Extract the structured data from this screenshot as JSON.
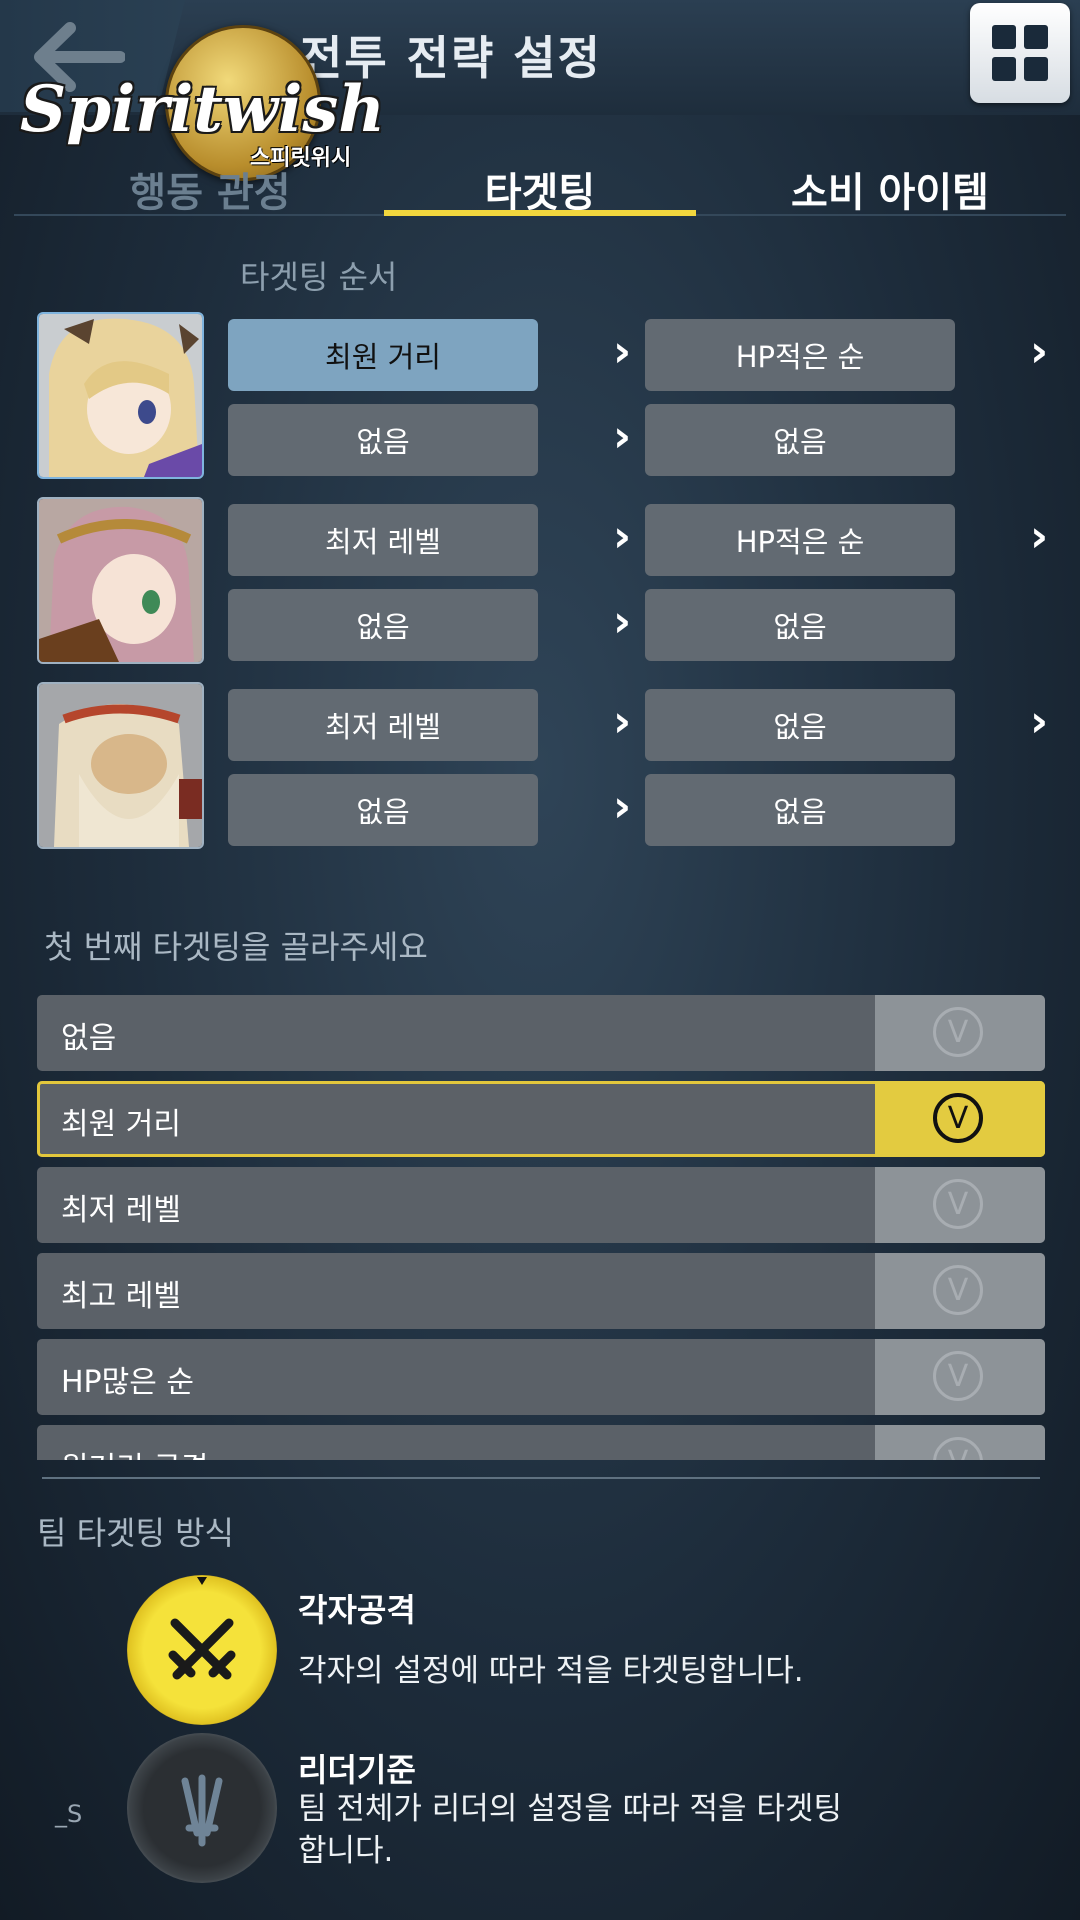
{
  "header": {
    "title": "전투 전략 설정"
  },
  "logo": {
    "name": "Spiritwish",
    "subtitle": "스피릿위시"
  },
  "tabs": [
    {
      "label": "행동 관정",
      "state": "partially-hidden"
    },
    {
      "label": "타겟팅",
      "state": "active"
    },
    {
      "label": "소비 아이템",
      "state": "inactive"
    }
  ],
  "targeting_order": {
    "label": "타겟팅 순서",
    "characters": [
      {
        "row1": [
          "최원 거리",
          "HP적은 순"
        ],
        "row2": [
          "없음",
          "없음"
        ],
        "selected_slot": "row1-0"
      },
      {
        "row1": [
          "최저 레벨",
          "HP적은 순"
        ],
        "row2": [
          "없음",
          "없음"
        ]
      },
      {
        "row1": [
          "최저 레벨",
          "없음"
        ],
        "row2": [
          "없음",
          "없음"
        ]
      }
    ]
  },
  "first_targeting": {
    "prompt": "첫 번째 타겟팅을 골라주세요",
    "options": [
      {
        "label": "없음",
        "selected": false
      },
      {
        "label": "최원 거리",
        "selected": true
      },
      {
        "label": "최저 레벨",
        "selected": false
      },
      {
        "label": "최고 레벨",
        "selected": false
      },
      {
        "label": "HP많은 순",
        "selected": false
      },
      {
        "label": "원거리 공격",
        "selected": false
      }
    ],
    "check_glyph": "V"
  },
  "team_targeting": {
    "label": "팀 타겟팅 방식",
    "modes": [
      {
        "title": "각자공격",
        "description": "각자의 설정에 따라 적을 타겟팅합니다.",
        "active": true,
        "icon": "crossed-swords-icon"
      },
      {
        "title": "리더기준",
        "description_line1": "팀 전체가 리더의 설정을 따라 적을 타겟팅",
        "description_line2": "합니다.",
        "active": false,
        "icon": "triple-swords-icon"
      }
    ],
    "side_mark": "_S"
  },
  "colors": {
    "accent_yellow": "#f2d73e",
    "option_bg": "#626a72",
    "option_selected_bg": "#7ea4c0"
  }
}
